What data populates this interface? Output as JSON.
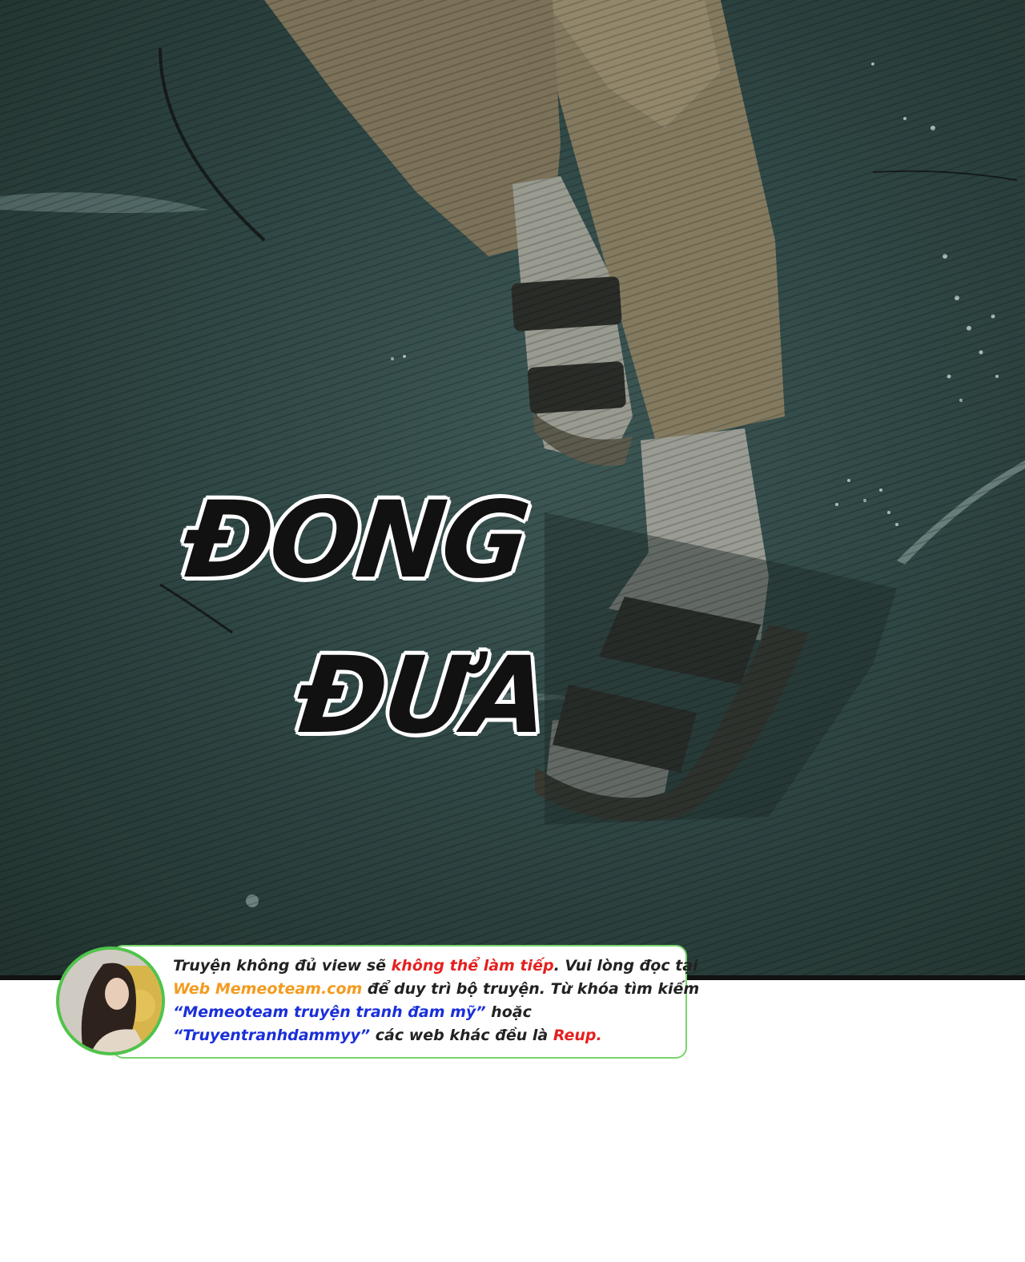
{
  "sfx": {
    "word1": "ĐONG",
    "word2": "ĐƯA"
  },
  "notice": {
    "line1_a": "Truyện không đủ view sẽ ",
    "line1_b": "không thể làm tiếp",
    "line1_c": ". Vui lòng đọc tại",
    "line2_a": "Web Memeoteam.com",
    "line2_b": " để duy trì bộ truyện. Từ khóa tìm kiếm",
    "line3_a": "“Memeoteam truyện tranh đam mỹ”",
    "line3_b": " hoặc",
    "line4_a": "“Truyentranhdammyy”",
    "line4_b": " các web khác đều là ",
    "line4_c": "Reup."
  },
  "colors": {
    "red": "#e5201f",
    "orange": "#f39b1e",
    "blue": "#1a2fd9",
    "border_green": "#7ad36e"
  }
}
